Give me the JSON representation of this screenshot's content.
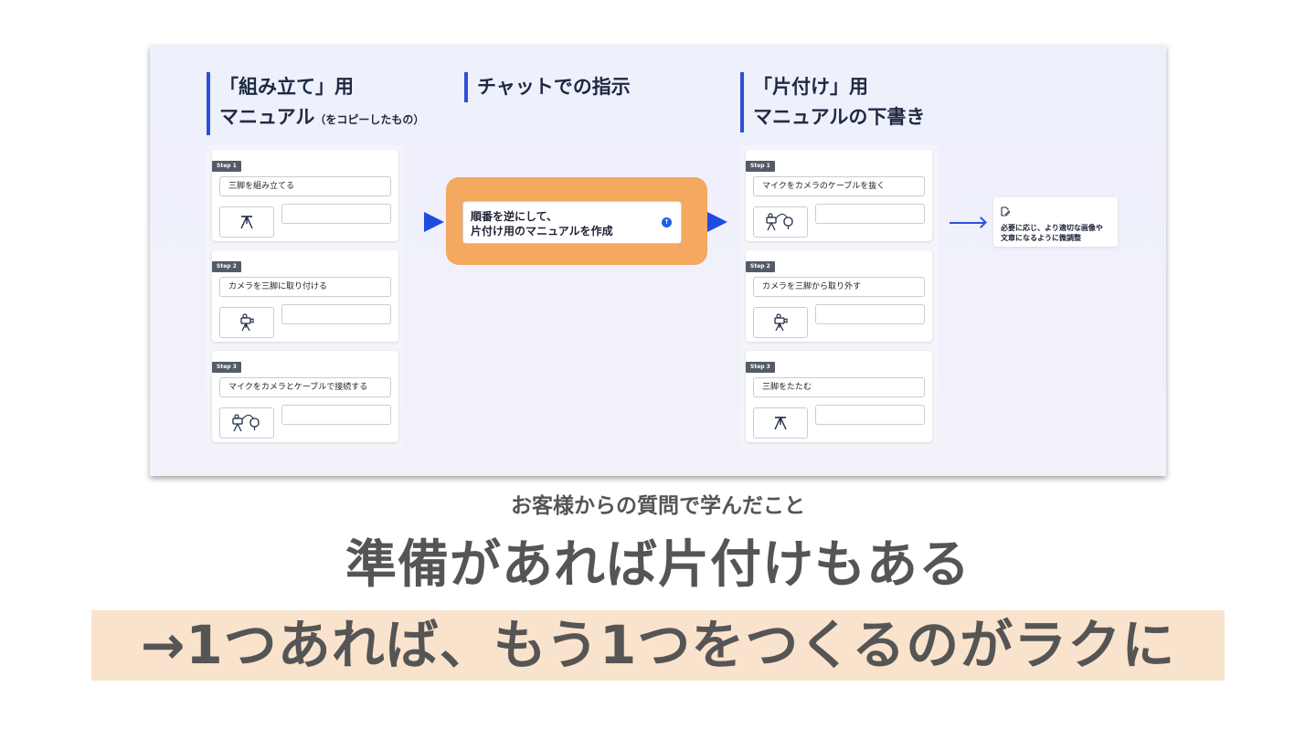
{
  "columns": {
    "left": {
      "title_line1": "「組み立て」用",
      "title_line2": "マニュアル",
      "title_note": "（をコピーしたもの）",
      "steps": [
        {
          "badge": "Step 1",
          "text": "三脚を組み立てる",
          "icon": "tripod-icon"
        },
        {
          "badge": "Step 2",
          "text": "カメラを三脚に取り付ける",
          "icon": "camera-on-tripod-icon"
        },
        {
          "badge": "Step 3",
          "text": "マイクをカメラとケーブルで接続する",
          "icon": "camera-mic-cable-icon"
        }
      ]
    },
    "middle": {
      "title": "チャットでの指示",
      "chat_line1": "順番を逆にして、",
      "chat_line2": "片付け用のマニュアルを作成",
      "send_icon": "send-icon"
    },
    "right": {
      "title_line1": "「片付け」用",
      "title_line2": "マニュアルの下書き",
      "steps": [
        {
          "badge": "Step 1",
          "text": "マイクをカメラのケーブルを抜く",
          "icon": "camera-mic-cable-icon"
        },
        {
          "badge": "Step 2",
          "text": "カメラを三脚から取り外す",
          "icon": "camera-on-tripod-icon"
        },
        {
          "badge": "Step 3",
          "text": "三脚をたたむ",
          "icon": "tripod-icon"
        }
      ]
    },
    "note": {
      "icon": "edit-note-icon",
      "line1": "必要に応じ、より適切な画像や",
      "line2": "文章になるように微調整"
    }
  },
  "caption": {
    "subtitle": "お客様からの質問で学んだこと",
    "headline": "準備があれば片付けもある",
    "highlight": "→1つあれば、もう1つをつくるのがラクに"
  },
  "colors": {
    "accent": "#2f4fd8",
    "chat_frame": "#f4a860",
    "highlight_bg": "#fae3cc",
    "caption_text": "#555555"
  }
}
